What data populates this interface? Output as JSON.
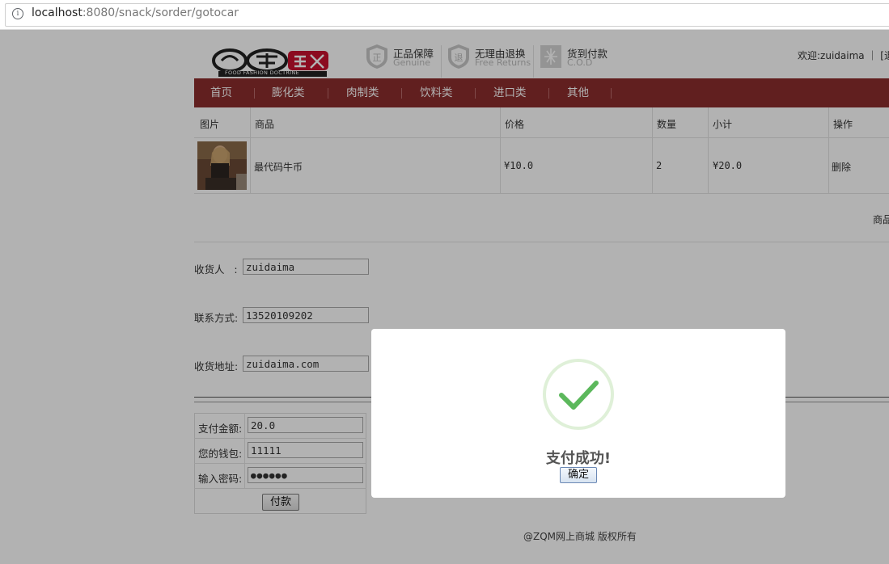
{
  "browser": {
    "url_host": "localhost",
    "url_rest": ":8080/snack/sorder/gotocar"
  },
  "header": {
    "logo_text": "食尚主义",
    "logo_sub": "FOOD FASHION DOCTRINE",
    "guarantees": [
      {
        "title": "正品保障",
        "sub": "Genuine",
        "icon": "genuine-badge-icon"
      },
      {
        "title": "无理由退换",
        "sub": "Free Returns",
        "icon": "returns-badge-icon"
      },
      {
        "title": "货到付款",
        "sub": "C.O.D",
        "icon": "cod-gift-icon"
      }
    ],
    "welcome": "欢迎:zuidaima ｜ [退出"
  },
  "nav": {
    "items": [
      "首页",
      "膨化类",
      "肉制类",
      "饮料类",
      "进口类",
      "其他"
    ]
  },
  "cart": {
    "headers": {
      "image": "图片",
      "product": "商品",
      "price": "价格",
      "qty": "数量",
      "subtotal": "小计",
      "action": "操作"
    },
    "rows": [
      {
        "product": "最代码牛币",
        "price": "¥10.0",
        "qty": "2",
        "subtotal": "¥20.0",
        "action": "删除"
      }
    ],
    "summary_partial": "商品"
  },
  "form": {
    "receiver_label": "收货人   :",
    "receiver_value": "zuidaima",
    "phone_label": "联系方式:",
    "phone_value": "13520109202",
    "address_label": "收货地址:",
    "address_value": "zuidaima.com"
  },
  "payment": {
    "amount_label": "支付金额:",
    "amount_value": "20.0",
    "wallet_label": "您的钱包:",
    "wallet_value": "11111",
    "password_label": "输入密码:",
    "password_value": "●●●●●●",
    "pay_button": "付款"
  },
  "footer": "@ZQM网上商城 版权所有",
  "dialog": {
    "title": "支付成功!",
    "confirm": "确定",
    "icon": "success-check-icon"
  },
  "colors": {
    "nav_bg": "#8b2d2d",
    "check_green": "#5cb85c",
    "logo_red": "#c8102e"
  }
}
